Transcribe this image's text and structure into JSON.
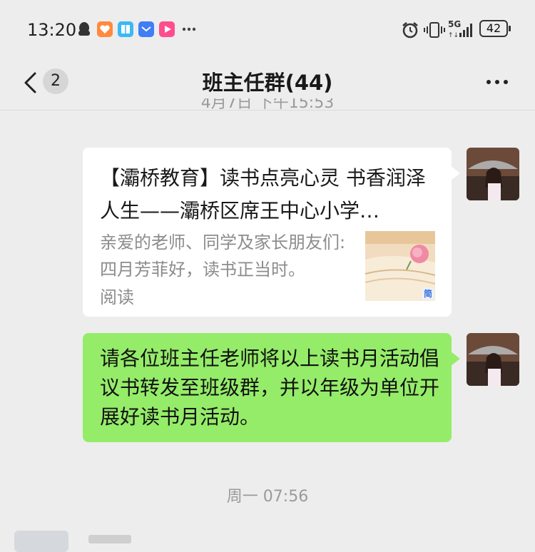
{
  "status_bar": {
    "time": "13:20",
    "network": "5G",
    "battery": "42",
    "icons": [
      "qq-icon",
      "heart-app-icon",
      "book-app-icon",
      "mail-app-icon",
      "video-app-icon",
      "more-dots-icon",
      "alarm-icon",
      "vibrate-icon",
      "signal-icon"
    ]
  },
  "nav": {
    "unread_count": "2",
    "title": "班主任群(44)"
  },
  "messages": {
    "cut_timestamp": "4月7日 下午15:53",
    "link_card": {
      "title": "【灞桥教育】读书点亮心灵 书香润泽人生——灞桥区席王中心小学…",
      "description": "亲爱的老师、同学及家长朋友们: 四月芳菲好，读书正当时。",
      "read_label": "阅读",
      "thumb_badge": "简"
    },
    "text_message": "请各位班主任老师将以上读书月活动倡议书转发至班级群，并以年级为单位开展好读书月活动。",
    "time_divider": "周一 07:56"
  },
  "colors": {
    "chat_background": "#ededed",
    "own_bubble": "#95ec69",
    "card_background": "#ffffff",
    "timestamp_text": "#9a9a9a"
  }
}
